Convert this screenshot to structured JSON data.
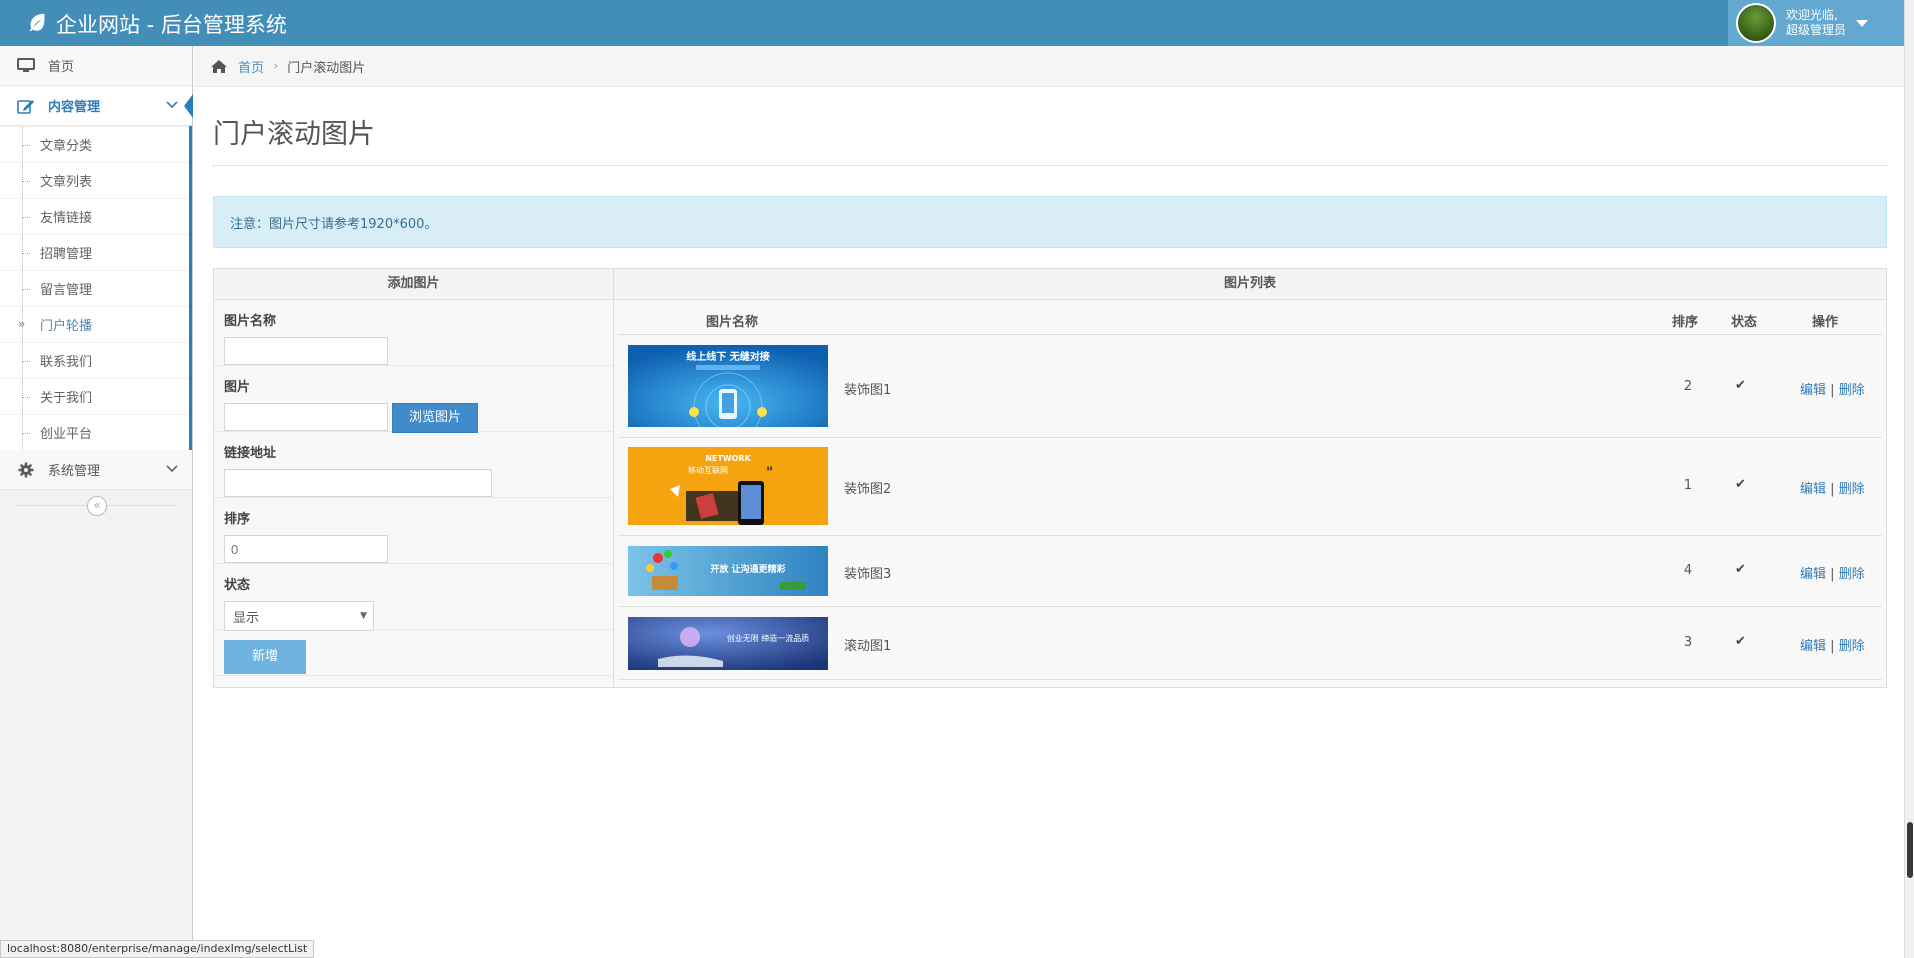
{
  "navbar": {
    "title": "企业网站 - 后台管理系统",
    "welcome_line1": "欢迎光临,",
    "welcome_line2": "超级管理员"
  },
  "sidebar": {
    "home_label": "首页",
    "content_label": "内容管理",
    "content_items": [
      {
        "label": "文章分类"
      },
      {
        "label": "文章列表"
      },
      {
        "label": "友情链接"
      },
      {
        "label": "招聘管理"
      },
      {
        "label": "留言管理"
      },
      {
        "label": "门户轮播"
      },
      {
        "label": "联系我们"
      },
      {
        "label": "关于我们"
      },
      {
        "label": "创业平台"
      }
    ],
    "active_item": "门户轮播",
    "system_label": "系统管理",
    "collapse_glyph": "«"
  },
  "breadcrumb": {
    "home": "首页",
    "current": "门户滚动图片"
  },
  "page": {
    "title": "门户滚动图片",
    "notice": "注意：图片尺寸请参考1920*600。"
  },
  "form": {
    "heading": "添加图片",
    "name_label": "图片名称",
    "name_value": "",
    "image_label": "图片",
    "image_value": "",
    "browse_label": "浏览图片",
    "link_label": "链接地址",
    "link_value": "",
    "sort_label": "排序",
    "sort_placeholder": "0",
    "status_label": "状态",
    "status_selected": "显示",
    "submit_label": "新增"
  },
  "list": {
    "heading": "图片列表",
    "columns": {
      "name": "图片名称",
      "sort": "排序",
      "status": "状态",
      "ops": "操作"
    },
    "rows": [
      {
        "name": "装饰图1",
        "sort": "2",
        "status": "✔",
        "edit": "编辑",
        "sep": "|",
        "delete": "删除",
        "banner_text": "线上线下 无缝对接",
        "banner_color": "#1e7fd0"
      },
      {
        "name": "装饰图2",
        "sort": "1",
        "status": "✔",
        "edit": "编辑",
        "sep": "|",
        "delete": "删除",
        "banner_text": "移动互联网",
        "banner_color": "#f5a40f"
      },
      {
        "name": "装饰图3",
        "sort": "4",
        "status": "✔",
        "edit": "编辑",
        "sep": "|",
        "delete": "删除",
        "banner_text": "开放 让沟通更精彩",
        "banner_color": "#3f95c9"
      },
      {
        "name": "滚动图1",
        "sort": "3",
        "status": "✔",
        "edit": "编辑",
        "sep": "|",
        "delete": "删除",
        "banner_text": "创业无限 缔造一流品质",
        "banner_color": "#2a4ea0"
      }
    ]
  },
  "statusbar": {
    "url": "localhost:8080/enterprise/manage/indexImg/selectList"
  },
  "colors": {
    "navbar": "#438eb9",
    "accent": "#2b7dbc",
    "notice_bg": "#d9edf7",
    "link": "#337ab7"
  }
}
